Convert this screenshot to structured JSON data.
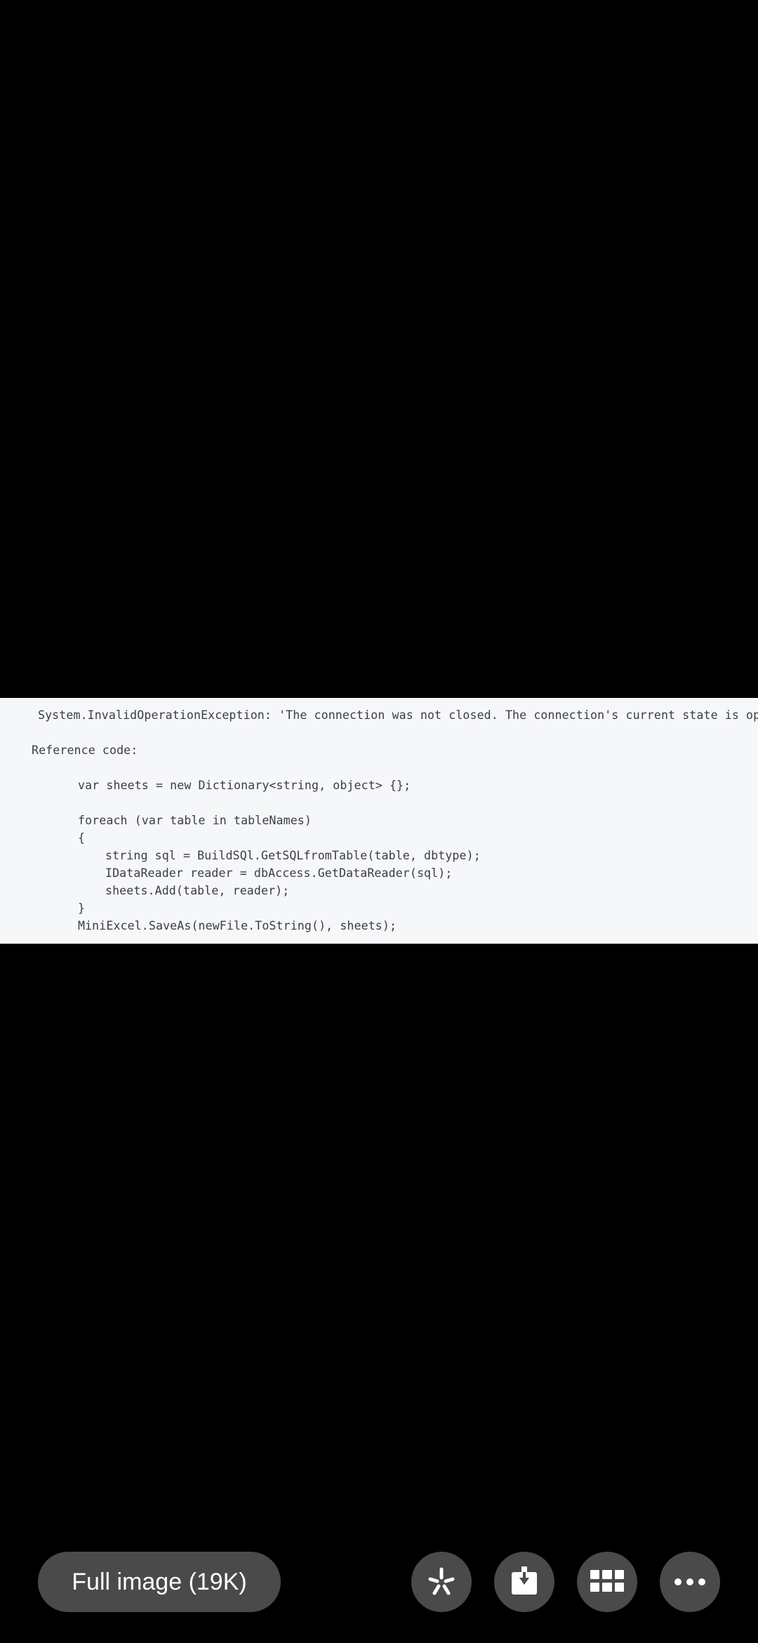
{
  "image": {
    "lines": [
      "System.InvalidOperationException: 'The connection was not closed. The connection's current state is open.'",
      "Reference code:",
      "var sheets = new Dictionary<string, object> {};",
      "foreach (var table in tableNames)",
      "{",
      "string sql = BuildSQl.GetSQLfromTable(table, dbtype);",
      "IDataReader reader = dbAccess.GetDataReader(sql);",
      "sheets.Add(table, reader);",
      "}",
      "MiniExcel.SaveAs(newFile.ToString(), sheets);"
    ]
  },
  "toolbar": {
    "full_image_label": "Full image (19K)",
    "buttons": [
      {
        "name": "lens",
        "icon": "lens-sparkle-icon"
      },
      {
        "name": "download",
        "icon": "download-icon"
      },
      {
        "name": "grid",
        "icon": "grid-icon"
      },
      {
        "name": "more",
        "icon": "more-dots-icon"
      }
    ]
  },
  "colors": {
    "background": "#000000",
    "image_background": "#f6f7f9",
    "button_background": "#4a4a4a",
    "button_text": "#ffffff",
    "code_text": "#3a3d44"
  }
}
